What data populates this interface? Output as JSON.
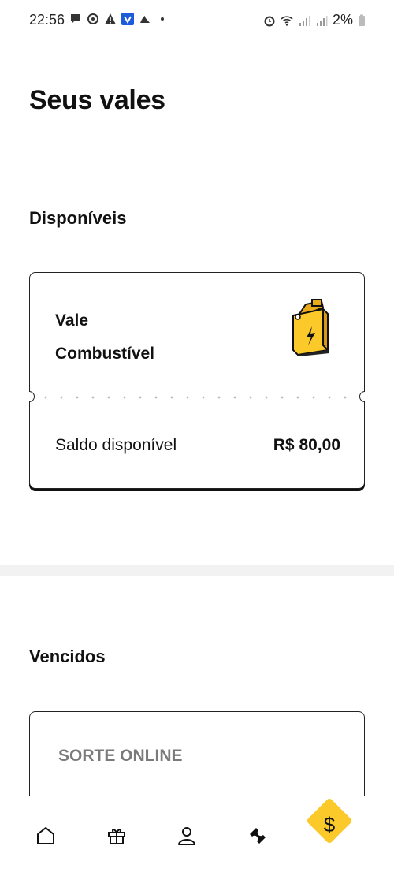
{
  "status_bar": {
    "time": "22:56",
    "battery_percent": "2%"
  },
  "page": {
    "title": "Seus vales"
  },
  "available": {
    "section_title": "Disponíveis",
    "voucher": {
      "title_line1": "Vale",
      "title_line2": "Combustível",
      "icon": "fuel-can-icon",
      "balance_label": "Saldo disponível",
      "balance_value": "R$ 80,00"
    }
  },
  "expired": {
    "section_title": "Vencidos",
    "voucher": {
      "title": "SORTE ONLINE"
    }
  },
  "bottom_nav": {
    "items": [
      {
        "icon": "home-icon"
      },
      {
        "icon": "gift-icon"
      },
      {
        "icon": "profile-icon"
      },
      {
        "icon": "ticket-icon"
      },
      {
        "icon": "dollar-icon",
        "label": "$"
      }
    ],
    "accent_color": "#fcc92a"
  }
}
